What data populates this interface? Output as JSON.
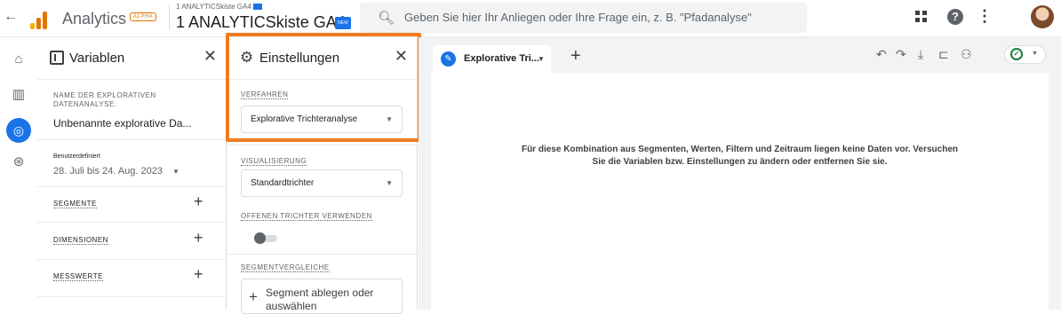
{
  "header": {
    "app_name": "Analytics",
    "alpha_badge": "ALPHA",
    "account_small": "1 ANALYTICSkiste GA4",
    "account_property": "1 ANALYTICSkiste GA4",
    "new_badge": "NEW",
    "search_placeholder": "Geben Sie hier Ihr Anliegen oder Ihre Frage ein, z. B. \"Pfadanalyse\"",
    "logo_colors": [
      "#f9ab00",
      "#e37400",
      "#e37400"
    ]
  },
  "variables": {
    "title": "Variablen",
    "name_label": "NAME DER EXPLORATIVEN DATENANALYSE:",
    "name_value": "Unbenannte explorative Da...",
    "date_type": "Benutzerdefiniert",
    "date_range": "28. Juli bis 24. Aug. 2023",
    "sections": [
      {
        "label": "SEGMENTE"
      },
      {
        "label": "DIMENSIONEN"
      },
      {
        "label": "MESSWERTE"
      }
    ]
  },
  "settings": {
    "title": "Einstellungen",
    "method_label": "VERFAHREN",
    "method_value": "Explorative Trichteranalyse",
    "visualization_label": "VISUALISIERUNG",
    "visualization_value": "Standardtrichter",
    "open_funnel_label": "OFFENEN TRICHTER VERWENDEN",
    "open_funnel_enabled": false,
    "segment_compare_label": "SEGMENTVERGLEICHE",
    "segment_drop_text": "Segment ablegen oder auswählen"
  },
  "canvas": {
    "tab_label": "Explorative Tri...",
    "empty_message": "Für diese Kombination aus Segmenten, Werten, Filtern und Zeitraum liegen keine Daten vor. Versuchen Sie die Variablen bzw. Einstellungen zu ändern oder entfernen Sie sie."
  },
  "colors": {
    "accent": "#1a73e8",
    "highlight": "#f07c1f",
    "success": "#188038"
  }
}
